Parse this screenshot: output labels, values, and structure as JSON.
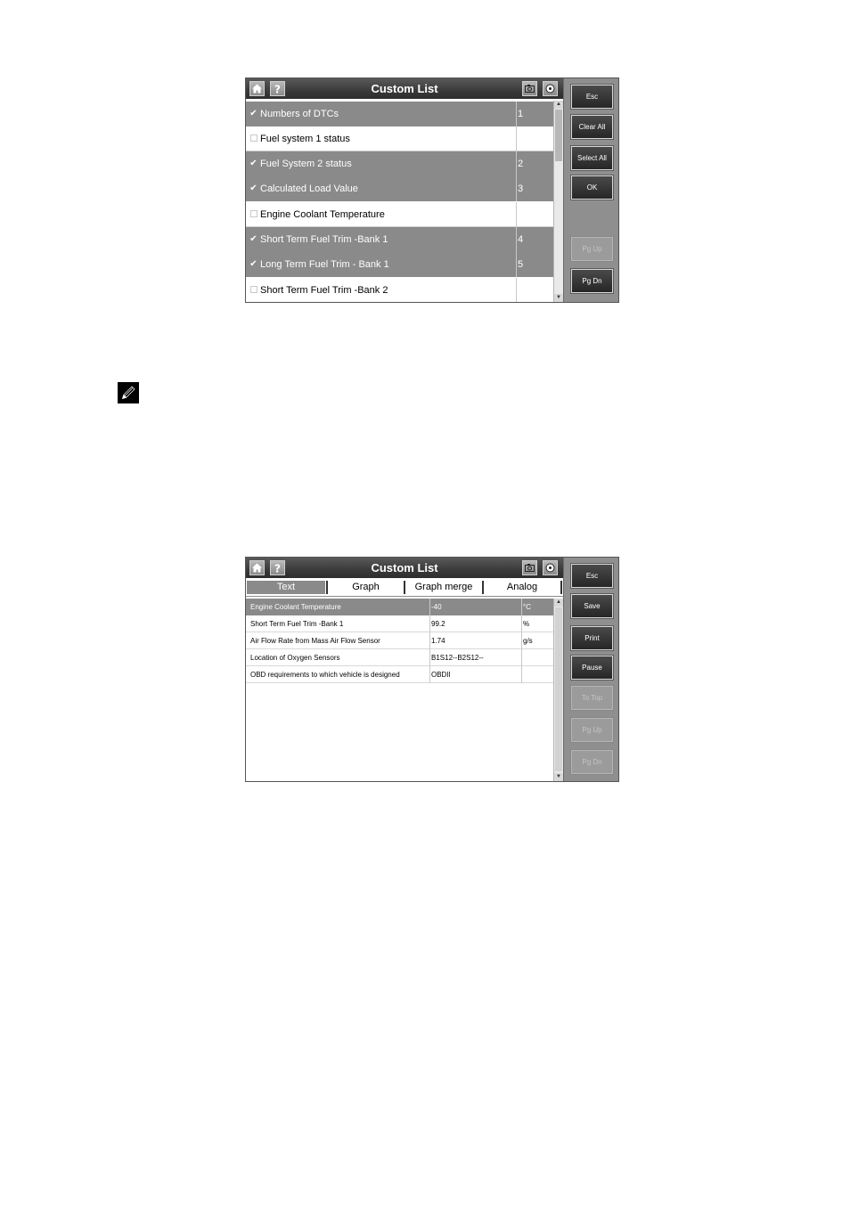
{
  "screen1": {
    "title": "Custom List",
    "rows": [
      {
        "label": "Numbers of DTCs",
        "value": "1",
        "checked": true
      },
      {
        "label": "Fuel system 1 status",
        "value": "",
        "checked": false
      },
      {
        "label": "Fuel System 2 status",
        "value": "2",
        "checked": true
      },
      {
        "label": "Calculated Load Value",
        "value": "3",
        "checked": true
      },
      {
        "label": "Engine Coolant Temperature",
        "value": "",
        "checked": false
      },
      {
        "label": "Short Term Fuel Trim -Bank 1",
        "value": "4",
        "checked": true
      },
      {
        "label": "Long Term Fuel Trim - Bank 1",
        "value": "5",
        "checked": true
      },
      {
        "label": "Short Term Fuel Trim -Bank 2",
        "value": "",
        "checked": false
      }
    ],
    "buttons": {
      "esc": "Esc",
      "clear_all": "Clear All",
      "select_all": "Select All",
      "ok": "OK",
      "pg_up": "Pg Up",
      "pg_dn": "Pg Dn"
    }
  },
  "screen2": {
    "title": "Custom List",
    "tabs": [
      "Text",
      "Graph",
      "Graph merge",
      "Analog"
    ],
    "rows": [
      {
        "name": "Engine Coolant Temperature",
        "value": "-40",
        "unit": "°C"
      },
      {
        "name": "Short Term Fuel Trim -Bank 1",
        "value": "99.2",
        "unit": "%"
      },
      {
        "name": "Air Flow Rate from Mass Air Flow Sensor",
        "value": "1.74",
        "unit": "g/s"
      },
      {
        "name": "Location of Oxygen Sensors",
        "value": "B1S12--B2S12--",
        "unit": ""
      },
      {
        "name": "OBD requirements to which vehicle is designed",
        "value": "OBDII",
        "unit": ""
      }
    ],
    "buttons": {
      "esc": "Esc",
      "save": "Save",
      "print": "Print",
      "pause": "Pause",
      "to_top": "To Top",
      "pg_up": "Pg Up",
      "pg_dn": "Pg Dn"
    }
  },
  "icons": {
    "home": "home-icon",
    "help": "help-icon",
    "camera": "camera-icon",
    "record": "record-icon",
    "note": "pencil-note-icon"
  }
}
